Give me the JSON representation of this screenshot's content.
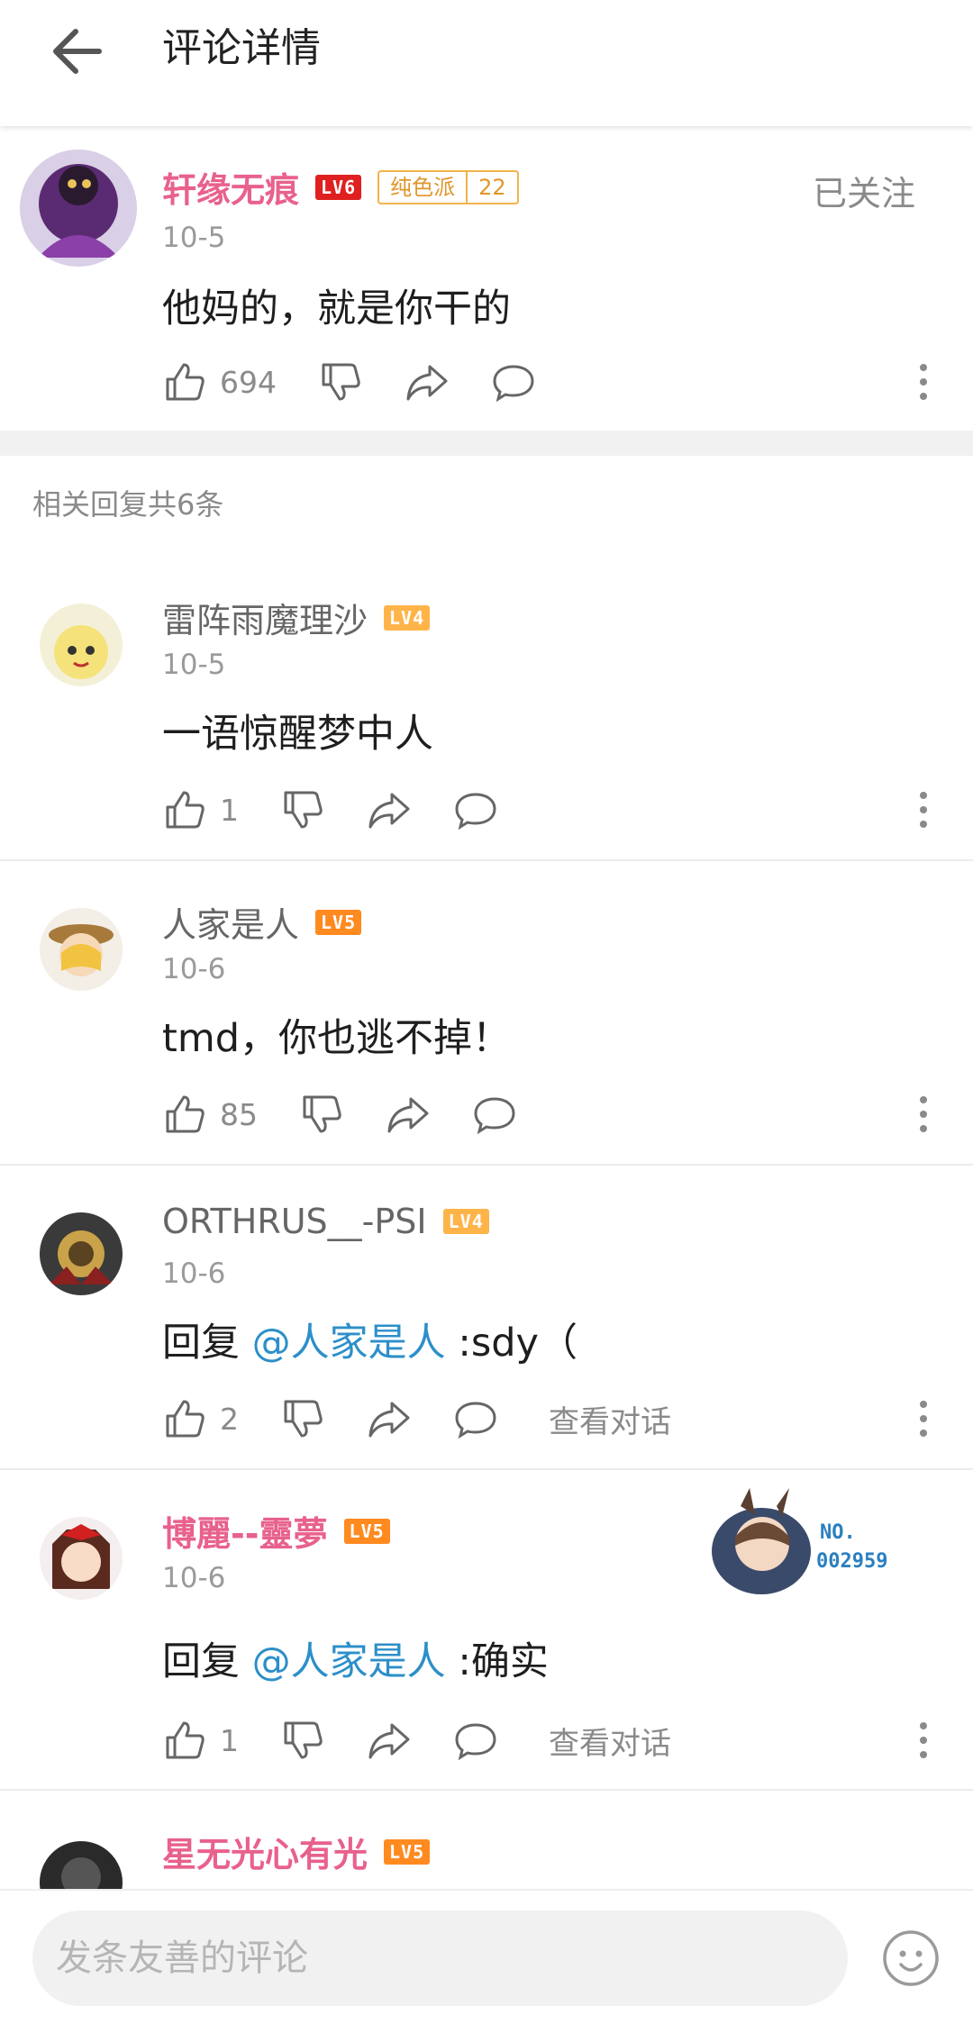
{
  "header": {
    "title": "评论详情"
  },
  "main_comment": {
    "username": "轩缘无痕",
    "level": "LV6",
    "fan_badge": {
      "name": "纯色派",
      "level": "22"
    },
    "follow_label": "已关注",
    "date": "10-5",
    "content": "他妈的，就是你干的",
    "likes": "694"
  },
  "replies_header": "相关回复共6条",
  "replies": [
    {
      "username": "雷阵雨魔理沙",
      "level": "LV4",
      "date": "10-5",
      "content": "一语惊醒梦中人",
      "likes": "1"
    },
    {
      "username": "人家是人",
      "level": "LV5",
      "date": "10-6",
      "content": "tmd，你也逃不掉！",
      "likes": "85"
    },
    {
      "username": "ORTHRUS__-PSI",
      "level": "LV4",
      "date": "10-6",
      "reply_prefix": "回复 ",
      "mention": "@人家是人",
      "content": " :sdy（",
      "likes": "2",
      "view_conversation": "查看对话"
    },
    {
      "username": "博麗--靈夢",
      "level": "LV5",
      "date": "10-6",
      "reply_prefix": "回复 ",
      "mention": "@人家是人",
      "content": " :确实",
      "likes": "1",
      "view_conversation": "查看对话",
      "badge_text_1": "NO.",
      "badge_text_2": "002959"
    },
    {
      "username": "星无光心有光",
      "level": "LV5"
    }
  ],
  "composer": {
    "placeholder": "发条友善的评论"
  },
  "colors": {
    "vip_name": "#e8618c",
    "mention": "#2c8fc9",
    "lv6": "#e02020",
    "lv5": "#ff8a1f",
    "lv4": "#ffb44a"
  },
  "icons": [
    "back-arrow-icon",
    "thumbs-up-icon",
    "thumbs-down-icon",
    "share-icon",
    "reply-bubble-icon",
    "more-vertical-icon",
    "emoji-icon"
  ]
}
